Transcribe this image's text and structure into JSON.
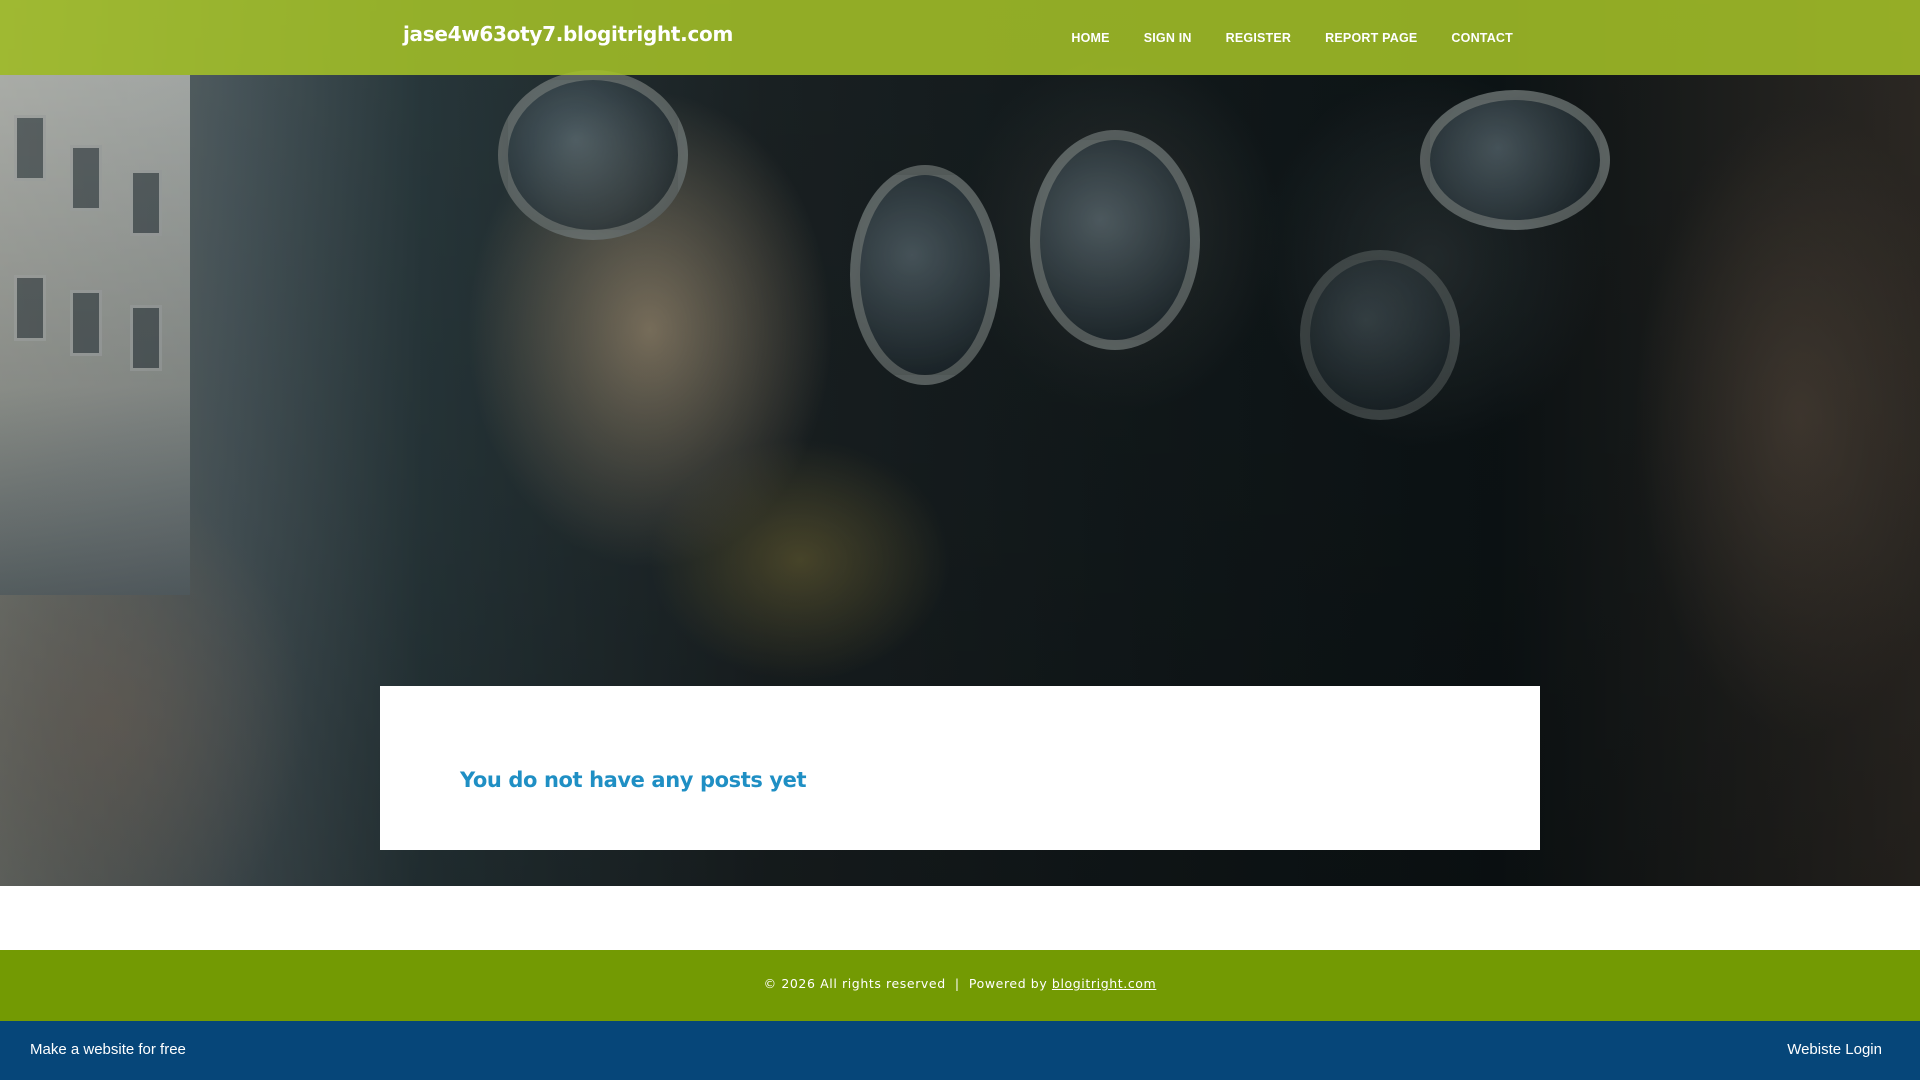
{
  "header": {
    "site_title": "jase4w63oty7.blogitright.com",
    "nav": [
      {
        "label": "HOME"
      },
      {
        "label": "SIGN IN"
      },
      {
        "label": "REGISTER"
      },
      {
        "label": "REPORT PAGE"
      },
      {
        "label": "CONTACT"
      }
    ]
  },
  "main": {
    "empty_message": "You do not have any posts yet"
  },
  "footer": {
    "copyright": "© 2026 All rights reserved",
    "separator": "|",
    "powered_by": "Powered by",
    "powered_link": "blogitright.com"
  },
  "bottom_bar": {
    "left_link": "Make a website for free",
    "right_link": "Webiste Login"
  },
  "colors": {
    "header_bg": "#a6c428",
    "footer_bg": "#739a03",
    "bottom_bar_bg": "#064679",
    "message_color": "#1f8fc4"
  },
  "hero": {
    "image_description_icon": "gas-masks-photo"
  }
}
